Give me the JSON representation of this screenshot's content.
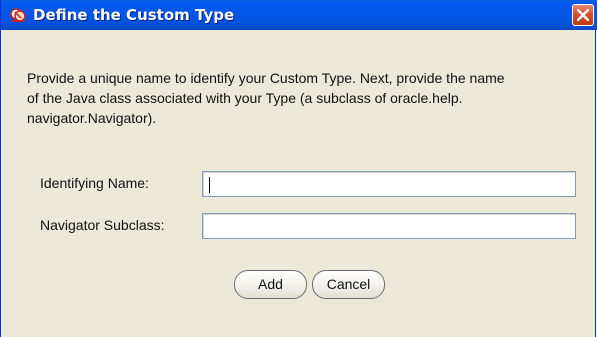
{
  "window": {
    "title": "Define the Custom Type",
    "icon": "app-icon",
    "close_icon": "close-icon"
  },
  "description": "Provide a unique name to identify your Custom Type. Next, provide the name of the Java class associated with your Type (a subclass of oracle.help.navigator.Navigator).",
  "description_lines": [
    "Provide a unique name to identify your Custom Type. Next, provide the name",
    "of the Java class associated with your Type (a subclass of oracle.help.",
    "navigator.Navigator)."
  ],
  "form": {
    "identifying_name": {
      "label": "Identifying Name:",
      "value": ""
    },
    "navigator_subclass": {
      "label": "Navigator Subclass:",
      "value": ""
    }
  },
  "buttons": {
    "add": "Add",
    "cancel": "Cancel"
  },
  "colors": {
    "titlebar": "#0456e8",
    "close_button": "#d7502f",
    "dialog_background": "#ece9d8",
    "field_border": "#7f9db9"
  }
}
